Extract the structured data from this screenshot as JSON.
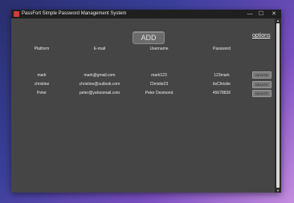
{
  "window": {
    "title": "PassFort Simple Password Management System",
    "minimize": "—",
    "maximize": "☐",
    "close": "✕"
  },
  "toolbar": {
    "add_label": "ADD",
    "options_label": "options"
  },
  "table": {
    "headers": [
      "Platform",
      "E-mail",
      "Username",
      "Password"
    ],
    "rows": [
      {
        "platform": "mark",
        "email": "mark@gmail.com",
        "username": "mark123",
        "password": "123mark",
        "action": "DELETE"
      },
      {
        "platform": "christine",
        "email": "christine@outlook.com",
        "username": "Christie23",
        "password": "itsChristie",
        "action": "DELETE"
      },
      {
        "platform": "Peter",
        "email": "peter@yahoomail.com",
        "username": "Peter Desmond",
        "password": "45678836",
        "action": "DELETE"
      }
    ]
  },
  "icons": {
    "app": "app-icon",
    "scroll_up": "▲",
    "scroll_down": "▼"
  },
  "colors": {
    "window_bg": "#454545",
    "titlebar_bg": "#1f1f1f",
    "app_icon": "#d63a3a"
  }
}
